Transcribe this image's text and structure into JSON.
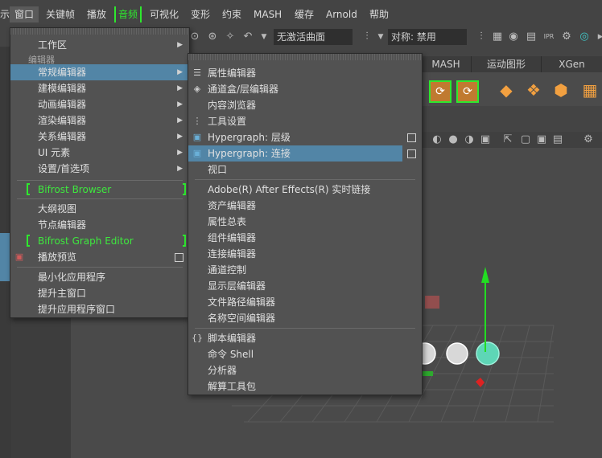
{
  "menubar": {
    "items": [
      {
        "label": "示"
      },
      {
        "label": "窗口"
      },
      {
        "label": "关键帧"
      },
      {
        "label": "播放"
      },
      {
        "label": "音频"
      },
      {
        "label": "可视化"
      },
      {
        "label": "变形"
      },
      {
        "label": "约束"
      },
      {
        "label": "MASH"
      },
      {
        "label": "缓存"
      },
      {
        "label": "Arnold"
      },
      {
        "label": "帮助"
      }
    ]
  },
  "toolbar": {
    "symmetry_field": "无激活曲面",
    "symmetry_label": "对称: 禁用"
  },
  "shelf": {
    "tabs": [
      {
        "label": "MASH"
      },
      {
        "label": "运动图形"
      },
      {
        "label": "XGen"
      }
    ]
  },
  "window_menu": {
    "items": [
      {
        "label": "工作区",
        "arrow": "▶"
      },
      {
        "label": "常规编辑器",
        "arrow": "▶"
      },
      {
        "label": "建模编辑器",
        "arrow": "▶"
      },
      {
        "label": "动画编辑器",
        "arrow": "▶"
      },
      {
        "label": "渲染编辑器",
        "arrow": "▶"
      },
      {
        "label": "关系编辑器",
        "arrow": "▶"
      },
      {
        "label": "UI 元素",
        "arrow": "▶"
      },
      {
        "label": "设置/首选项",
        "arrow": "▶"
      },
      {
        "label": "Bifrost Browser"
      },
      {
        "label": "大纲视图"
      },
      {
        "label": "节点编辑器"
      },
      {
        "label": "Bifrost Graph Editor"
      },
      {
        "label": "播放预览"
      },
      {
        "label": "最小化应用程序"
      },
      {
        "label": "提升主窗口"
      },
      {
        "label": "提升应用程序窗口"
      }
    ],
    "section_label": "编辑器"
  },
  "general_editors_menu": {
    "items": [
      {
        "label": "属性编辑器"
      },
      {
        "label": "通道盒/层编辑器"
      },
      {
        "label": "内容浏览器"
      },
      {
        "label": "工具设置"
      },
      {
        "label": "Hypergraph: 层级"
      },
      {
        "label": "Hypergraph: 连接"
      },
      {
        "label": "视口"
      },
      {
        "label": "Adobe(R) After Effects(R) 实时链接"
      },
      {
        "label": "资产编辑器"
      },
      {
        "label": "属性总表"
      },
      {
        "label": "组件编辑器"
      },
      {
        "label": "连接编辑器"
      },
      {
        "label": "通道控制"
      },
      {
        "label": "显示层编辑器"
      },
      {
        "label": "文件路径编辑器"
      },
      {
        "label": "名称空间编辑器"
      },
      {
        "label": "脚本编辑器"
      },
      {
        "label": "命令 Shell"
      },
      {
        "label": "分析器"
      },
      {
        "label": "解算工具包"
      }
    ]
  },
  "colors": {
    "highlight": "#5285a6",
    "bracket_green": "#2ee82e",
    "menu_bg": "#525252"
  }
}
